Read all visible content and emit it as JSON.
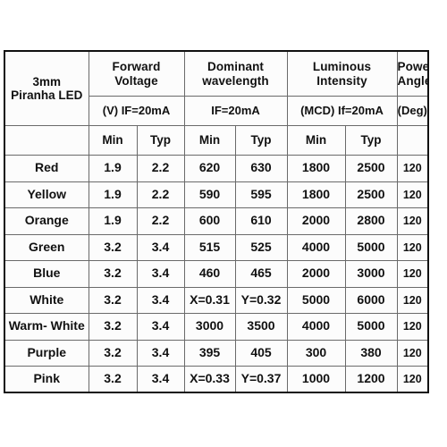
{
  "sheet": {
    "corner": {
      "line1": "3mm",
      "line2": "Piranha LED"
    },
    "groups": [
      {
        "id": "forward-voltage",
        "line1": "Forward",
        "line2": "Voltage",
        "unit": "(V) IF=20mA"
      },
      {
        "id": "dominant-wavelength",
        "line1": "Dominant",
        "line2": "wavelength",
        "unit": "IF=20mA"
      },
      {
        "id": "luminous-intensity",
        "line1": "Luminous",
        "line2": "Intensity",
        "unit": "(MCD) If=20mA"
      },
      {
        "id": "power-angle",
        "line1": "Power",
        "line2": "Angle",
        "unit": "(Deg)"
      }
    ],
    "subheaders": {
      "fv_min": "Min",
      "fv_typ": "Typ",
      "dw_min": "Min",
      "dw_typ": "Typ",
      "li_min": "Min",
      "li_typ": "Typ",
      "angle": ""
    },
    "colors": {
      "header_blue": "#0000d8",
      "grid_line": "#6a6a6a",
      "outer_border": "#111111",
      "cell_background": "#fcfcfc",
      "page_background": "#ffffff"
    },
    "rows": [
      {
        "name": "Red",
        "swatch": "#ee0000",
        "text_color": "#ffdde0",
        "fv_min": "1.9",
        "fv_typ": "2.2",
        "dw_min": "620",
        "dw_typ": "630",
        "li_min": "1800",
        "li_typ": "2500",
        "angle": "120"
      },
      {
        "name": "Yellow",
        "swatch": "#ffe81b",
        "text_color": "#111111",
        "fv_min": "1.9",
        "fv_typ": "2.2",
        "dw_min": "590",
        "dw_typ": "595",
        "li_min": "1800",
        "li_typ": "2500",
        "angle": "120"
      },
      {
        "name": "Orange",
        "swatch": "#f5a81c",
        "text_color": "#2a2000",
        "fv_min": "1.9",
        "fv_typ": "2.2",
        "dw_min": "600",
        "dw_typ": "610",
        "li_min": "2000",
        "li_typ": "2800",
        "angle": "120"
      },
      {
        "name": "Green",
        "swatch": "#15e534",
        "text_color": "#0a5a12",
        "fv_min": "3.2",
        "fv_typ": "3.4",
        "dw_min": "515",
        "dw_typ": "525",
        "li_min": "4000",
        "li_typ": "5000",
        "angle": "120"
      },
      {
        "name": "Blue",
        "swatch": "#1212e0",
        "text_color": "#eceaff",
        "fv_min": "3.2",
        "fv_typ": "3.4",
        "dw_min": "460",
        "dw_typ": "465",
        "li_min": "2000",
        "li_typ": "3000",
        "angle": "120"
      },
      {
        "name": "White",
        "swatch": "#fdfdfb",
        "text_color": "#111111",
        "fv_min": "3.2",
        "fv_typ": "3.4",
        "dw_min": "X=0.31",
        "dw_typ": "Y=0.32",
        "li_min": "5000",
        "li_typ": "6000",
        "angle": "120"
      },
      {
        "name": "Warm- White",
        "swatch": "#f4f0a8",
        "text_color": "#111111",
        "fv_min": "3.2",
        "fv_typ": "3.4",
        "dw_min": "3000",
        "dw_typ": "3500",
        "li_min": "4000",
        "li_typ": "5000",
        "angle": "120"
      },
      {
        "name": "Purple",
        "swatch": "#6a2c9c",
        "text_color": "#d9b4ee",
        "fv_min": "3.2",
        "fv_typ": "3.4",
        "dw_min": "395",
        "dw_typ": "405",
        "li_min": "300",
        "li_typ": "380",
        "angle": "120"
      },
      {
        "name": "Pink",
        "swatch": "#f718f7",
        "text_color": "#9b63a8",
        "fv_min": "3.2",
        "fv_typ": "3.4",
        "dw_min": "X=0.33",
        "dw_typ": "Y=0.37",
        "li_min": "1000",
        "li_typ": "1200",
        "angle": "120"
      }
    ]
  }
}
